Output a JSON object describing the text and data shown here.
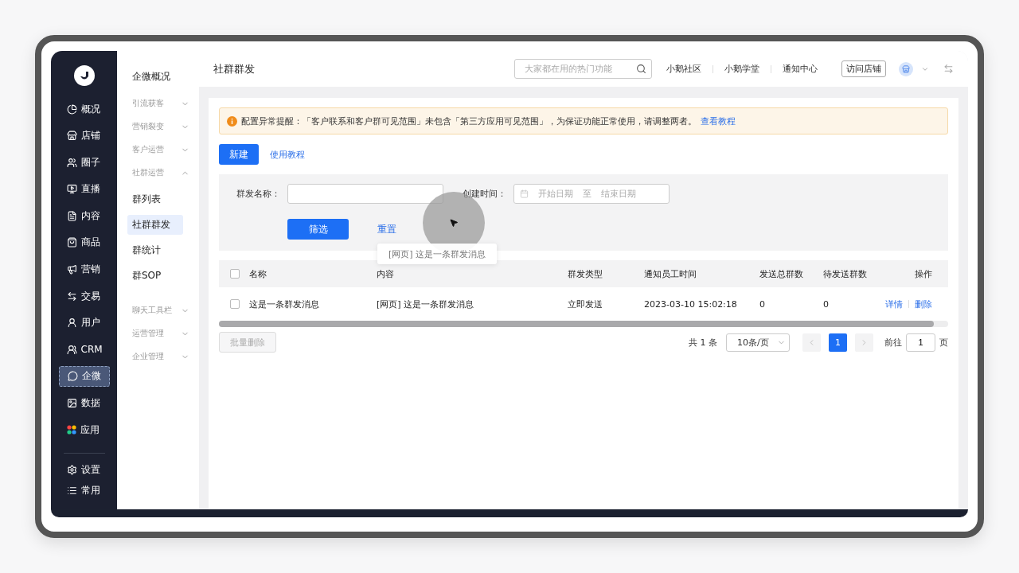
{
  "nav": {
    "items": [
      {
        "label": "概况",
        "selected": false
      },
      {
        "label": "店铺",
        "selected": false
      },
      {
        "label": "圈子",
        "selected": false
      },
      {
        "label": "直播",
        "selected": false
      },
      {
        "label": "内容",
        "selected": false
      },
      {
        "label": "商品",
        "selected": false
      },
      {
        "label": "营销",
        "selected": false
      },
      {
        "label": "交易",
        "selected": false
      },
      {
        "label": "用户",
        "selected": false
      },
      {
        "label": "CRM",
        "selected": false
      },
      {
        "label": "企微",
        "selected": true
      },
      {
        "label": "数据",
        "selected": false
      },
      {
        "label": "应用",
        "selected": false
      }
    ],
    "bottom": [
      {
        "label": "设置"
      },
      {
        "label": "常用"
      }
    ]
  },
  "subnav": {
    "overview": "企微概况",
    "groups": [
      {
        "label": "引流获客",
        "expanded": false
      },
      {
        "label": "营销裂变",
        "expanded": false
      },
      {
        "label": "客户运营",
        "expanded": false
      },
      {
        "label": "社群运营",
        "expanded": true,
        "children": [
          {
            "label": "群列表",
            "selected": false
          },
          {
            "label": "社群群发",
            "selected": true
          },
          {
            "label": "群统计",
            "selected": false
          },
          {
            "label": "群SOP",
            "selected": false
          }
        ]
      },
      {
        "label": "聊天工具栏",
        "expanded": false
      },
      {
        "label": "运营管理",
        "expanded": false
      },
      {
        "label": "企业管理",
        "expanded": false
      }
    ]
  },
  "header": {
    "title": "社群群发",
    "search": {
      "placeholder": "大家都在用的热门功能"
    },
    "links": [
      "小鹅社区",
      "小鹅学堂",
      "通知中心"
    ],
    "visit_button": "访问店铺"
  },
  "alert": {
    "text": "配置异常提醒：「客户联系和客户群可见范围」未包含「第三方应用可见范围」，为保证功能正常使用，请调整两者。",
    "link": "查看教程"
  },
  "toolbar": {
    "new_button": "新建",
    "tutorial_link": "使用教程"
  },
  "filter": {
    "name_label": "群发名称：",
    "date_label": "创建时间：",
    "start_placeholder": "开始日期",
    "separator": "至",
    "end_placeholder": "结束日期",
    "filter_button": "筛选",
    "reset_link": "重置"
  },
  "table": {
    "all_checked": false,
    "columns": [
      "名称",
      "内容",
      "群发类型",
      "通知员工时间",
      "发送总群数",
      "待发送群数",
      "操作"
    ],
    "rows": [
      {
        "checked": false,
        "cells": [
          "这是一条群发消息",
          "[网页] 这是一条群发消息",
          "立即发送",
          "2023-03-10 15:02:18",
          "0",
          "0"
        ],
        "actions": [
          "详情",
          "删除"
        ]
      }
    ],
    "tooltip": "[网页] 这是一条群发消息"
  },
  "batch_delete": {
    "label": "批量删除",
    "disabled": true
  },
  "pagination": {
    "total": "共 1 条",
    "page_size": "10条/页",
    "pages": [
      {
        "label": "1",
        "selected": true
      }
    ],
    "goto_label": "前往",
    "goto_value": "1",
    "goto_unit": "页"
  }
}
